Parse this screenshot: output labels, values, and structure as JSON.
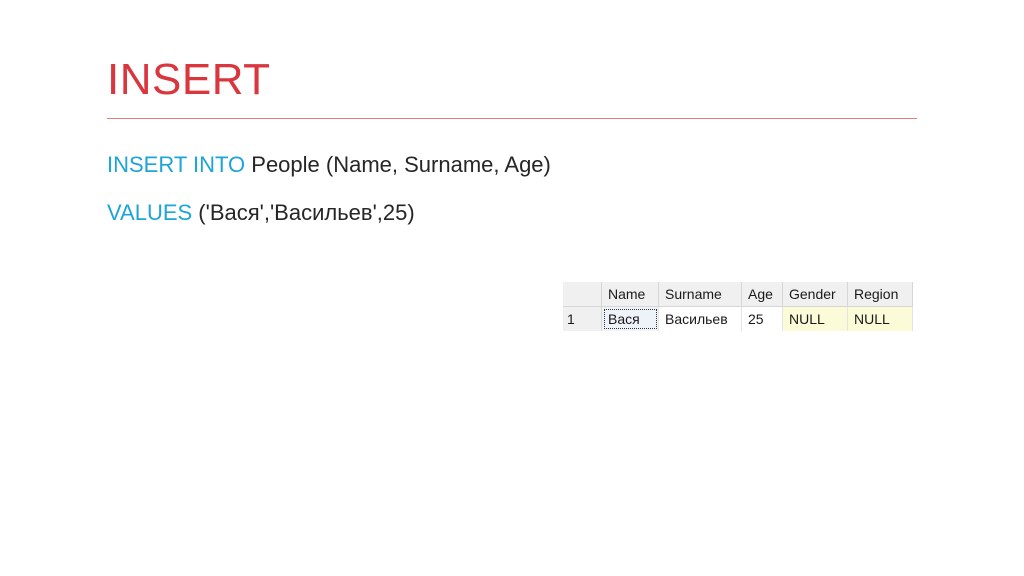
{
  "slide": {
    "title": "INSERT",
    "line1": {
      "keyword": "INSERT INTO",
      "rest": " People (Name, Surname, Age)"
    },
    "line2": {
      "keyword": "VALUES",
      "rest": " ('Вася','Васильев',25)"
    }
  },
  "result_grid": {
    "columns": [
      "Name",
      "Surname",
      "Age",
      "Gender",
      "Region"
    ],
    "rows": [
      {
        "num": "1",
        "cells": [
          "Вася",
          "Васильев",
          "25",
          "NULL",
          "NULL"
        ]
      }
    ]
  },
  "colors": {
    "title": "#d9363e",
    "keyword": "#1ea4d8",
    "null_background": "#fbfbd8"
  }
}
